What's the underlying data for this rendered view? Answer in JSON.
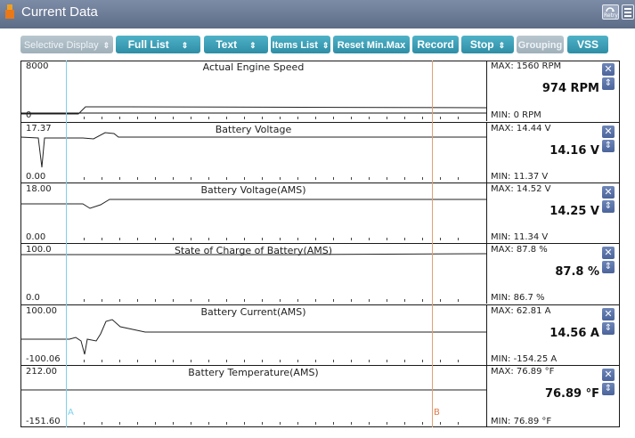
{
  "window": {
    "title": "Current Data",
    "retry_label": "Retry"
  },
  "toolbar": {
    "selective_display": "Selective Display",
    "full_list": "Full List",
    "text": "Text",
    "items_list": "Items List",
    "reset_min_max": "Reset Min.Max",
    "record": "Record",
    "stop": "Stop",
    "grouping": "Grouping",
    "vss": "VSS"
  },
  "cursors": {
    "a": "A",
    "b": "B"
  },
  "panels": [
    {
      "name": "Actual Engine Speed",
      "ymax": "8000",
      "ymin": "0",
      "max": "MAX:  1560 RPM",
      "min": "MIN:    0 RPM",
      "current": "974 RPM"
    },
    {
      "name": "Battery Voltage",
      "ymax": "17.37",
      "ymin": "0.00",
      "max": "MAX: 14.44 V",
      "min": "MIN: 11.37 V",
      "current": "14.16 V"
    },
    {
      "name": "Battery Voltage(AMS)",
      "ymax": "18.00",
      "ymin": "0.00",
      "max": "MAX: 14.52 V",
      "min": "MIN: 11.34 V",
      "current": "14.25 V"
    },
    {
      "name": "State of Charge of Battery(AMS)",
      "ymax": "100.0",
      "ymin": "0.0",
      "max": "MAX:  87.8 %",
      "min": "MIN:  86.7 %",
      "current": "87.8 %"
    },
    {
      "name": "Battery Current(AMS)",
      "ymax": "100.00",
      "ymin": "-100.06",
      "max": "MAX: 62.81 A",
      "min": "MIN: -154.25 A",
      "current": "14.56 A"
    },
    {
      "name": "Battery Temperature(AMS)",
      "ymax": "212.00",
      "ymin": "-151.60",
      "max": "MAX: 76.89 °F",
      "min": "MIN: 76.89 °F",
      "current": "76.89 °F"
    }
  ]
}
